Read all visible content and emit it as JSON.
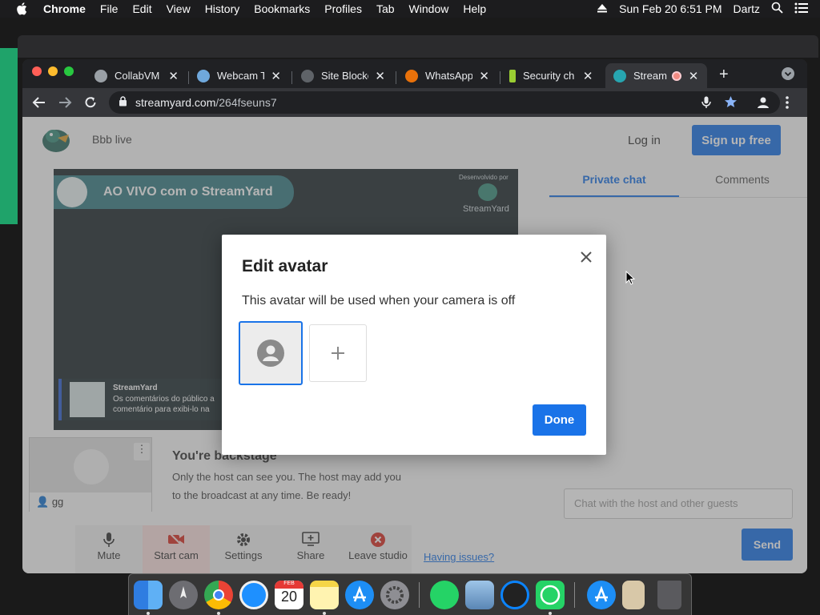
{
  "menubar": {
    "app": "Chrome",
    "items": [
      "File",
      "Edit",
      "View",
      "History",
      "Bookmarks",
      "Profiles",
      "Tab",
      "Window",
      "Help"
    ],
    "clock": "Sun Feb 20  6:51 PM",
    "user": "Dartz"
  },
  "tabs": [
    {
      "title": "CollabVM S",
      "color": "#9aa0a6"
    },
    {
      "title": "Webcam Te",
      "color": "#6fa8dc"
    },
    {
      "title": "Site Blocke",
      "color": "#5f6368"
    },
    {
      "title": "WhatsApp",
      "color": "#e8710a"
    },
    {
      "title": "Security ch",
      "color": "#9acd32"
    },
    {
      "title": "Stream",
      "color": "#27a5b0"
    }
  ],
  "address": {
    "host": "streamyard.com",
    "path": "/264fseuns7"
  },
  "page": {
    "studio_name": "Bbb live",
    "login": "Log in",
    "signup": "Sign up free",
    "banner": "AO VIVO com o StreamYard",
    "brand_small": "StreamYard",
    "brand_caption": "Desenvolvido por",
    "comment_author": "StreamYard",
    "comment_line1": "Os comentários do público a",
    "comment_line2": "comentário para exibi-lo na",
    "tab_private": "Private chat",
    "tab_comments": "Comments",
    "guest_name": "gg",
    "backstage_title": "You're backstage",
    "backstage_line1": "Only the host can see you. The host may add you",
    "backstage_line2": "to the broadcast at any time. Be ready!",
    "chat_placeholder": "Chat with the host and other guests",
    "send": "Send",
    "controls": [
      "Mute",
      "Start cam",
      "Settings",
      "Share",
      "Leave studio"
    ],
    "having_issues": "Having issues?"
  },
  "dialog": {
    "title": "Edit avatar",
    "subtitle": "This avatar will be used when your camera is off",
    "done": "Done"
  },
  "dock_date": "20",
  "dock_month": "FEB",
  "colors": {
    "accent": "#1a73e8",
    "signup": "#1a73e8",
    "overlay": "#5a5a5a"
  }
}
